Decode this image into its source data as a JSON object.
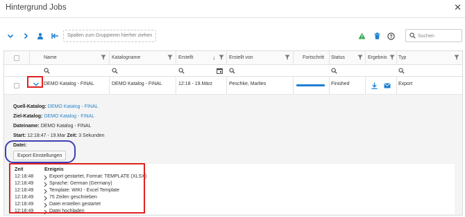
{
  "window": {
    "title": "Hintergrund Jobs",
    "close_glyph": "✕"
  },
  "toolbar": {
    "group_placeholder": "Spalten zum Gruppieren hierher ziehen",
    "search_placeholder": "Suchen",
    "icons": [
      "collapse-all-icon",
      "expand-all-icon",
      "user-icon",
      "back-arrow-icon",
      "warning-icon",
      "trash-icon",
      "help-icon",
      "search-icon"
    ],
    "warning_color": "#34a853"
  },
  "grid": {
    "columns": [
      "Name",
      "Katalogname",
      "Erstellt",
      "Erstellt von",
      "Fortschritt",
      "Status",
      "Ergebnis",
      "Typ"
    ],
    "sort_indicator": "↓",
    "rows": [
      {
        "name": "DEMO Katalog - FINAL",
        "katalog": "DEMO Katalog - FINAL",
        "erstellt": "12:18 - 19.März",
        "erstellt_von": "Peschke, Marlies",
        "progress": 1.0,
        "status": "Finished",
        "typ": "Export"
      }
    ]
  },
  "detail": {
    "quell_label": "Quell-Katalog:",
    "quell_value": "DEMO Katalog - FINAL",
    "ziel_label": "Ziel-Katalog:",
    "ziel_value": "DEMO Katalog - FINAL",
    "datei_label": "Dateiname:",
    "datei_value": "DEMO Katalog - FINAL",
    "start_label": "Start:",
    "start_value": "12:18:47 - 19.Mar",
    "zeit_label": "Zeit:",
    "zeit_value": "3 Sekunden",
    "datei2_label": "Datei:",
    "export_button": "Export Einstellungen",
    "events_header_time": "Zeit",
    "events_header_event": "Ereignis",
    "events": [
      {
        "time": "12:18:48",
        "msg": "Export gestartet, Format: TEMPLATE (XLSX)"
      },
      {
        "time": "12:18:49",
        "msg": "Sprache: German (Germany)"
      },
      {
        "time": "12:18:49",
        "msg": "Template: WIKI - Excel Template"
      },
      {
        "time": "12:18:49",
        "msg": "75 Zeilen geschrieben"
      },
      {
        "time": "12:18:49",
        "msg": "Datei erstellen gestartet"
      },
      {
        "time": "12:18:49",
        "msg": "Datei hochladen"
      }
    ]
  },
  "colors": {
    "accent": "#1e7fd1",
    "link": "#2a86c8",
    "highlight_red": "#e02020",
    "highlight_blue": "#3e3eb8"
  }
}
